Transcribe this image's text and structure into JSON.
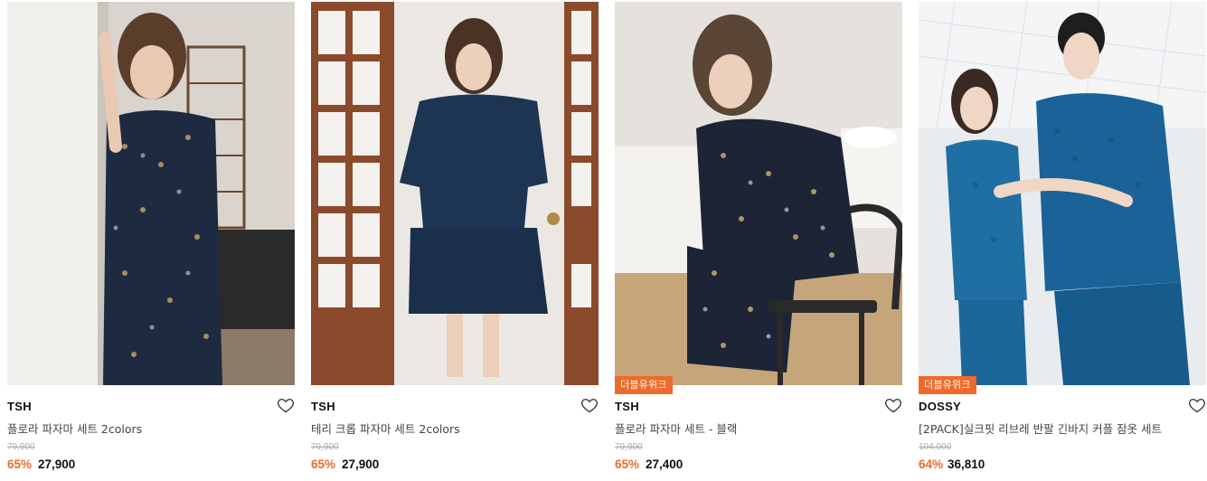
{
  "products": [
    {
      "brand": "TSH",
      "name": "플로라 파자마 세트 2colors",
      "original_price": "79,900",
      "discount": "65%",
      "price": "27,900",
      "badge": "",
      "image": "woman-in-floral-pajama-leaning-on-wall"
    },
    {
      "brand": "TSH",
      "name": "테리 크롭 파자마 세트 2colors",
      "original_price": "79,900",
      "discount": "65%",
      "price": "27,900",
      "badge": "",
      "image": "woman-in-navy-terry-pajama-by-door"
    },
    {
      "brand": "TSH",
      "name": "플로라 파자마 세트 - 블랙",
      "original_price": "79,900",
      "discount": "65%",
      "price": "27,400",
      "badge": "더블유위크",
      "image": "woman-in-floral-pajama-sitting-on-stool"
    },
    {
      "brand": "DOSSY",
      "name": "[2PACK]실크핏 리브레 반팔 긴바지 커플 잠옷 세트",
      "original_price": "104,000",
      "discount": "64%",
      "price": "36,810",
      "badge": "더블유위크",
      "image": "couple-in-blue-check-pajamas"
    }
  ],
  "colors": {
    "accent": "#ef6a2a",
    "text": "#111111",
    "muted": "#aaaaaa"
  },
  "icons": {
    "wishlist": "heart-outline-icon"
  }
}
